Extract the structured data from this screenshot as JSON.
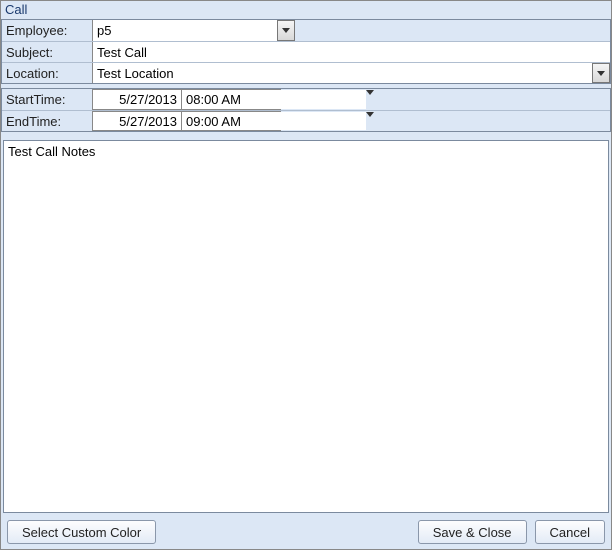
{
  "title": "Call",
  "labels": {
    "employee": "Employee:",
    "subject": "Subject:",
    "location": "Location:",
    "start_time": "StartTime:",
    "end_time": "EndTime:"
  },
  "fields": {
    "employee": "p5",
    "subject": "Test Call",
    "location": "Test Location",
    "start_date": "5/27/2013",
    "start_time": "08:00 AM",
    "end_date": "5/27/2013",
    "end_time": "09:00 AM",
    "notes": "Test Call Notes"
  },
  "buttons": {
    "select_color": "Select Custom Color",
    "save_close": "Save & Close",
    "cancel": "Cancel"
  }
}
